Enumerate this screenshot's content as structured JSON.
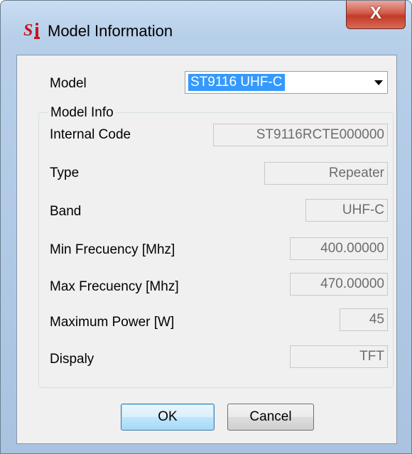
{
  "window": {
    "title": "Model Information",
    "close_label": "X",
    "app_icon": "st-logo-icon"
  },
  "model": {
    "label": "Model",
    "selected": "ST9116 UHF-C"
  },
  "model_info": {
    "group_title": "Model Info",
    "fields": [
      {
        "label": "Internal Code",
        "value": "ST9116RCTE000000"
      },
      {
        "label": "Type",
        "value": "Repeater"
      },
      {
        "label": "Band",
        "value": "UHF-C"
      },
      {
        "label": "Min Frecuency [Mhz]",
        "value": "400.00000"
      },
      {
        "label": "Max Frecuency [Mhz]",
        "value": "470.00000"
      },
      {
        "label": "Maximum Power [W]",
        "value": "45"
      },
      {
        "label": "Dispaly",
        "value": "TFT"
      }
    ]
  },
  "buttons": {
    "ok": "OK",
    "cancel": "Cancel"
  },
  "colors": {
    "selection": "#3399ff",
    "close_button": "#c94a37",
    "client_bg": "#f0f0f0"
  }
}
